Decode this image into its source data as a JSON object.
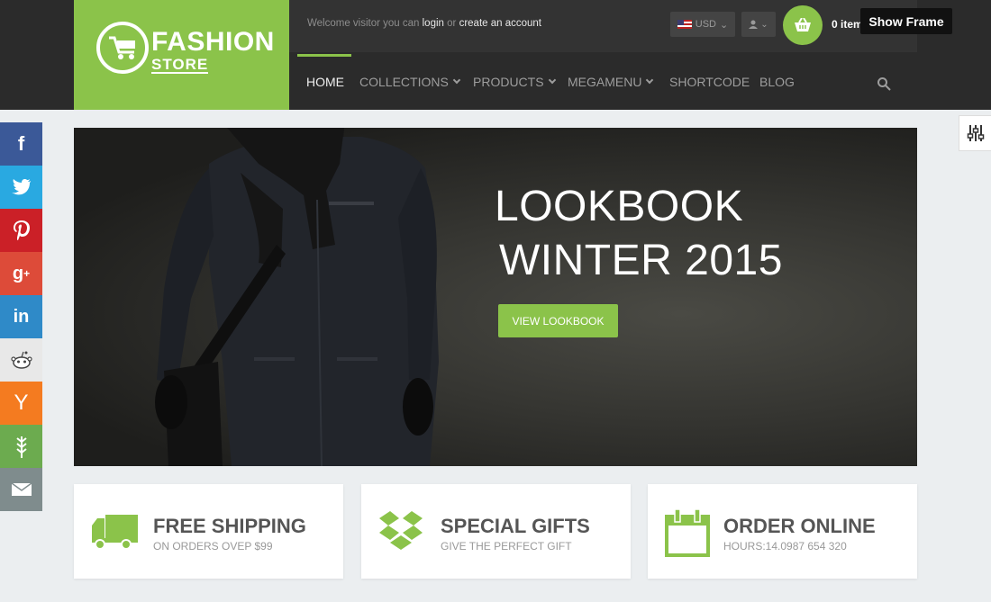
{
  "brand": {
    "title": "FASHION",
    "subtitle": "STORE",
    "accent": "#8bc34a"
  },
  "topbar": {
    "welcome_prefix": "Welcome visitor you can",
    "login": "login",
    "or": "or",
    "create_account": "create an account",
    "currency": "USD",
    "cart_count": "0 item"
  },
  "show_frame": "Show Frame",
  "nav": {
    "items": [
      {
        "label": "HOME",
        "active": true
      },
      {
        "label": "COLLECTIONS",
        "dropdown": true
      },
      {
        "label": "PRODUCTS",
        "dropdown": true
      },
      {
        "label": "MEGAMENU",
        "dropdown": true
      },
      {
        "label": "SHORTCODE"
      },
      {
        "label": "BLOG"
      }
    ]
  },
  "social": [
    {
      "name": "facebook",
      "glyph": "f",
      "color": "#3b5998"
    },
    {
      "name": "twitter",
      "glyph": "t",
      "color": "#29a9e1"
    },
    {
      "name": "pinterest",
      "glyph": "P",
      "color": "#cb2027"
    },
    {
      "name": "google-plus",
      "glyph": "g+",
      "color": "#dd4b39"
    },
    {
      "name": "linkedin",
      "glyph": "in",
      "color": "#2f8ac8"
    },
    {
      "name": "reddit",
      "glyph": "r",
      "color": "#e8e8e8"
    },
    {
      "name": "hacker-news",
      "glyph": "Y",
      "color": "#f47b20"
    },
    {
      "name": "vine",
      "glyph": "v",
      "color": "#6cab4f"
    },
    {
      "name": "email",
      "glyph": "✉",
      "color": "#7f8c8d"
    }
  ],
  "hero": {
    "line1": "LOOKBOOK",
    "line2": "WINTER 2015",
    "button": "VIEW LOOKBOOK"
  },
  "features": [
    {
      "title": "FREE SHIPPING",
      "sub": "ON ORDERS OVEP $99",
      "icon": "truck-icon"
    },
    {
      "title": "SPECIAL GIFTS",
      "sub": "GIVE THE PERFECT GIFT",
      "icon": "dropbox-icon"
    },
    {
      "title": "ORDER ONLINE",
      "sub": "HOURS:14.0987 654 320",
      "icon": "calendar-icon"
    }
  ]
}
